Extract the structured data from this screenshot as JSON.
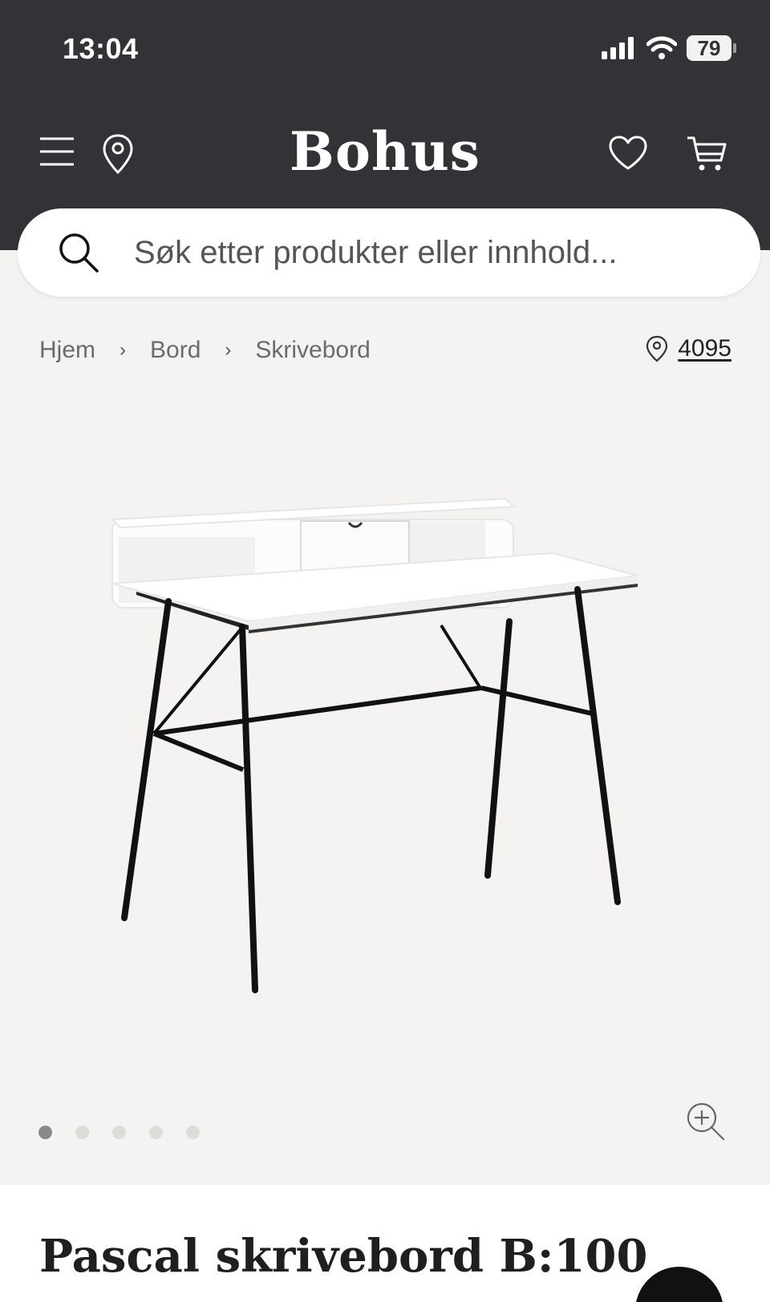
{
  "status_bar": {
    "time": "13:04",
    "battery": "79",
    "icons": [
      "signal-icon",
      "wifi-icon",
      "battery-icon"
    ]
  },
  "header": {
    "logo": "Bohus",
    "icons": {
      "left": [
        "menu-icon",
        "location-pin-icon"
      ],
      "right": [
        "heart-icon",
        "cart-icon"
      ]
    }
  },
  "search": {
    "placeholder": "Søk etter produkter eller innhold..."
  },
  "breadcrumb": {
    "items": [
      "Hjem",
      "Bord",
      "Skrivebord"
    ],
    "separator": "›"
  },
  "location": {
    "postal_code": "4095"
  },
  "gallery": {
    "total_images": 5,
    "active_index": 0
  },
  "product": {
    "title": "Pascal skrivebord B:100"
  },
  "colors": {
    "header_bg": "#333236",
    "page_bg": "#f4f3f1",
    "text_dark": "#1f1f1f"
  }
}
